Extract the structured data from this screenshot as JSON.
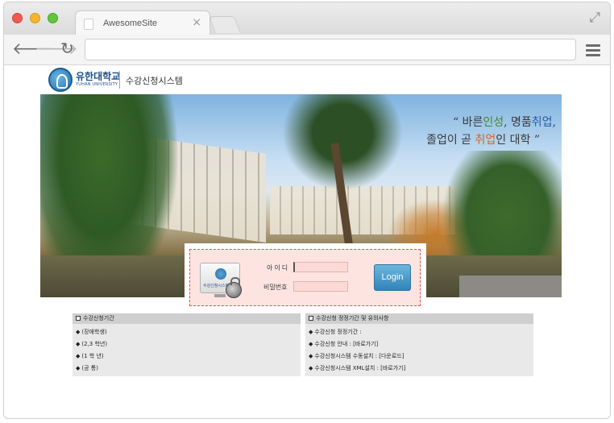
{
  "browser": {
    "tab_title": "AwesomeSite",
    "tab_close": "×",
    "url": "",
    "icons": {
      "back": "arrow-left-icon",
      "forward": "arrow-right-icon",
      "reload": "reload-icon",
      "menu": "hamburger-menu-icon",
      "expand": "expand-icon"
    }
  },
  "header": {
    "university_name": "유한대학교",
    "university_sub": "YUHAN UNIVERSITY",
    "system_title": "수강신청시스템"
  },
  "banner": {
    "slogan_open": "“",
    "slogan_close": "”",
    "slogan_line1_a": "바른",
    "slogan_line1_b": "인성",
    "slogan_line1_c": ", 명품",
    "slogan_line1_d": "취업",
    "slogan_line1_e": ",",
    "slogan_line2_a": "졸업이 곧 ",
    "slogan_line2_b": "취업",
    "slogan_line2_c": "인 대학"
  },
  "login": {
    "monitor_caption": "수강신청시스템",
    "id_label": "아이디",
    "password_label": "비밀번호",
    "id_value": "",
    "password_value": "",
    "button_label": "Login"
  },
  "left_panel": {
    "title": "수강신청기간",
    "items": [
      "(장애학생)",
      "(2,3 학년)",
      "(1  학  년)",
      "(공      통)"
    ]
  },
  "right_panel": {
    "title": "수강신청 정정기간 및 유의사항",
    "items": [
      "수강신청 정정기간 :",
      "수강신청 안내 : [바로가기]",
      "수강신청시스템 수동설치 : [다운로드]",
      "수강신청시스템 XML설치 : [바로가기]"
    ]
  },
  "colors": {
    "slogan_green": "#3f8a2e",
    "slogan_blue": "#2a5ea6",
    "slogan_orange": "#d9661f",
    "login_box_bg": "#fde4e1",
    "login_button": "#3f93c4"
  }
}
